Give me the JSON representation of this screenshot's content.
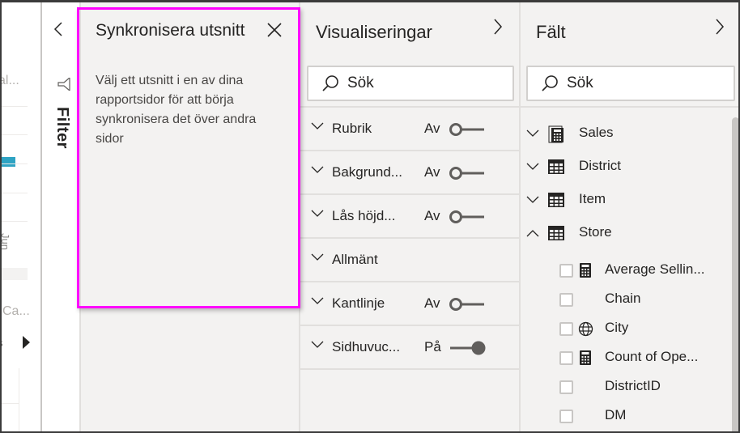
{
  "canvas": {
    "partial_labels": [
      "al...",
      "Ca...",
      "s"
    ],
    "rotated_label": "Jun",
    "bar_color": "#2ea3c3"
  },
  "filter_pane": {
    "label": "Filter",
    "collapse_icon": "chevron-left-icon",
    "icon": "funnel-icon"
  },
  "sync_slicers": {
    "title": "Synkronisera utsnitt",
    "close_icon": "close-icon",
    "description": "Välj ett utsnitt i en av dina rapportsidor för att börja synkronisera det över andra sidor",
    "highlight_color": "#ff00ff"
  },
  "visualizations": {
    "title": "Visualiseringar",
    "expand_icon": "chevron-right-icon",
    "search_placeholder": "Sök",
    "cards": [
      {
        "label": "Rubrik",
        "state": "Av",
        "toggle_on": false,
        "has_toggle": true
      },
      {
        "label": "Bakgrund...",
        "state": "Av",
        "toggle_on": false,
        "has_toggle": true
      },
      {
        "label": "Lås höjd...",
        "state": "Av",
        "toggle_on": false,
        "has_toggle": true
      },
      {
        "label": "Allmänt",
        "state": "",
        "toggle_on": false,
        "has_toggle": false
      },
      {
        "label": "Kantlinje",
        "state": "Av",
        "toggle_on": false,
        "has_toggle": true
      },
      {
        "label": "Sidhuvuc...",
        "state": "På",
        "toggle_on": true,
        "has_toggle": true
      }
    ]
  },
  "fields": {
    "title": "Fält",
    "expand_icon": "chevron-right-icon",
    "search_placeholder": "Sök",
    "tables": [
      {
        "name": "Sales",
        "icon": "calculator-table-icon",
        "expanded": false
      },
      {
        "name": "District",
        "icon": "table-icon",
        "expanded": false
      },
      {
        "name": "Item",
        "icon": "table-icon",
        "expanded": false
      },
      {
        "name": "Store",
        "icon": "table-icon",
        "expanded": true
      }
    ],
    "store_fields": [
      {
        "name": "Average Sellin...",
        "icon": "calculator-icon",
        "checked": false
      },
      {
        "name": "Chain",
        "icon": "",
        "checked": false
      },
      {
        "name": "City",
        "icon": "globe-icon",
        "checked": false
      },
      {
        "name": "Count of Ope...",
        "icon": "calculator-icon",
        "checked": false
      },
      {
        "name": "DistrictID",
        "icon": "",
        "checked": false
      },
      {
        "name": "DM",
        "icon": "",
        "checked": false
      }
    ]
  }
}
